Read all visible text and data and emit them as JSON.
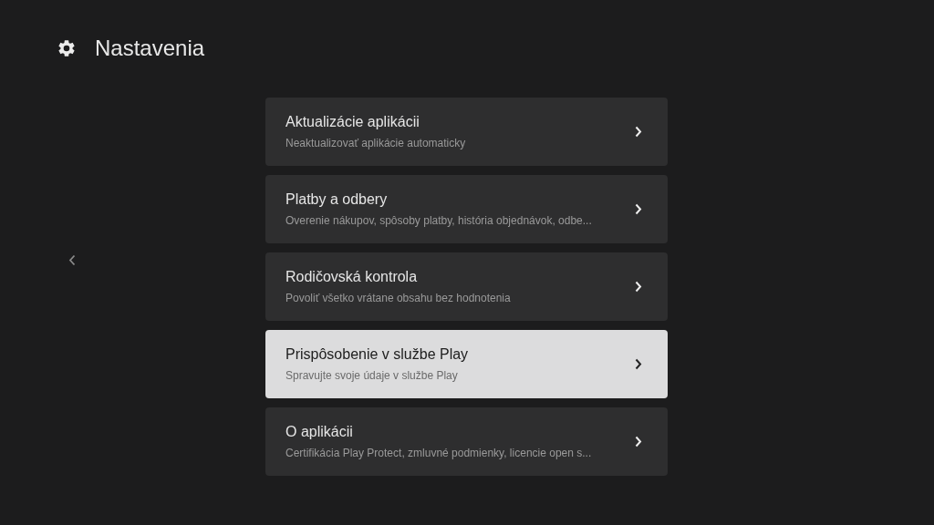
{
  "header": {
    "title": "Nastavenia"
  },
  "items": [
    {
      "title": "Aktualizácie aplikácii",
      "subtitle": "Neaktualizovať aplikácie automaticky",
      "selected": false
    },
    {
      "title": "Platby a odbery",
      "subtitle": "Overenie nákupov, spôsoby platby, história objednávok, odbe...",
      "selected": false
    },
    {
      "title": "Rodičovská kontrola",
      "subtitle": "Povoliť všetko vrátane obsahu bez hodnotenia",
      "selected": false
    },
    {
      "title": "Prispôsobenie v službe Play",
      "subtitle": "Spravujte svoje údaje v službe Play",
      "selected": true
    },
    {
      "title": "O aplikácii",
      "subtitle": "Certifikácia Play Protect, zmluvné podmienky, licencie open s...",
      "selected": false
    }
  ]
}
